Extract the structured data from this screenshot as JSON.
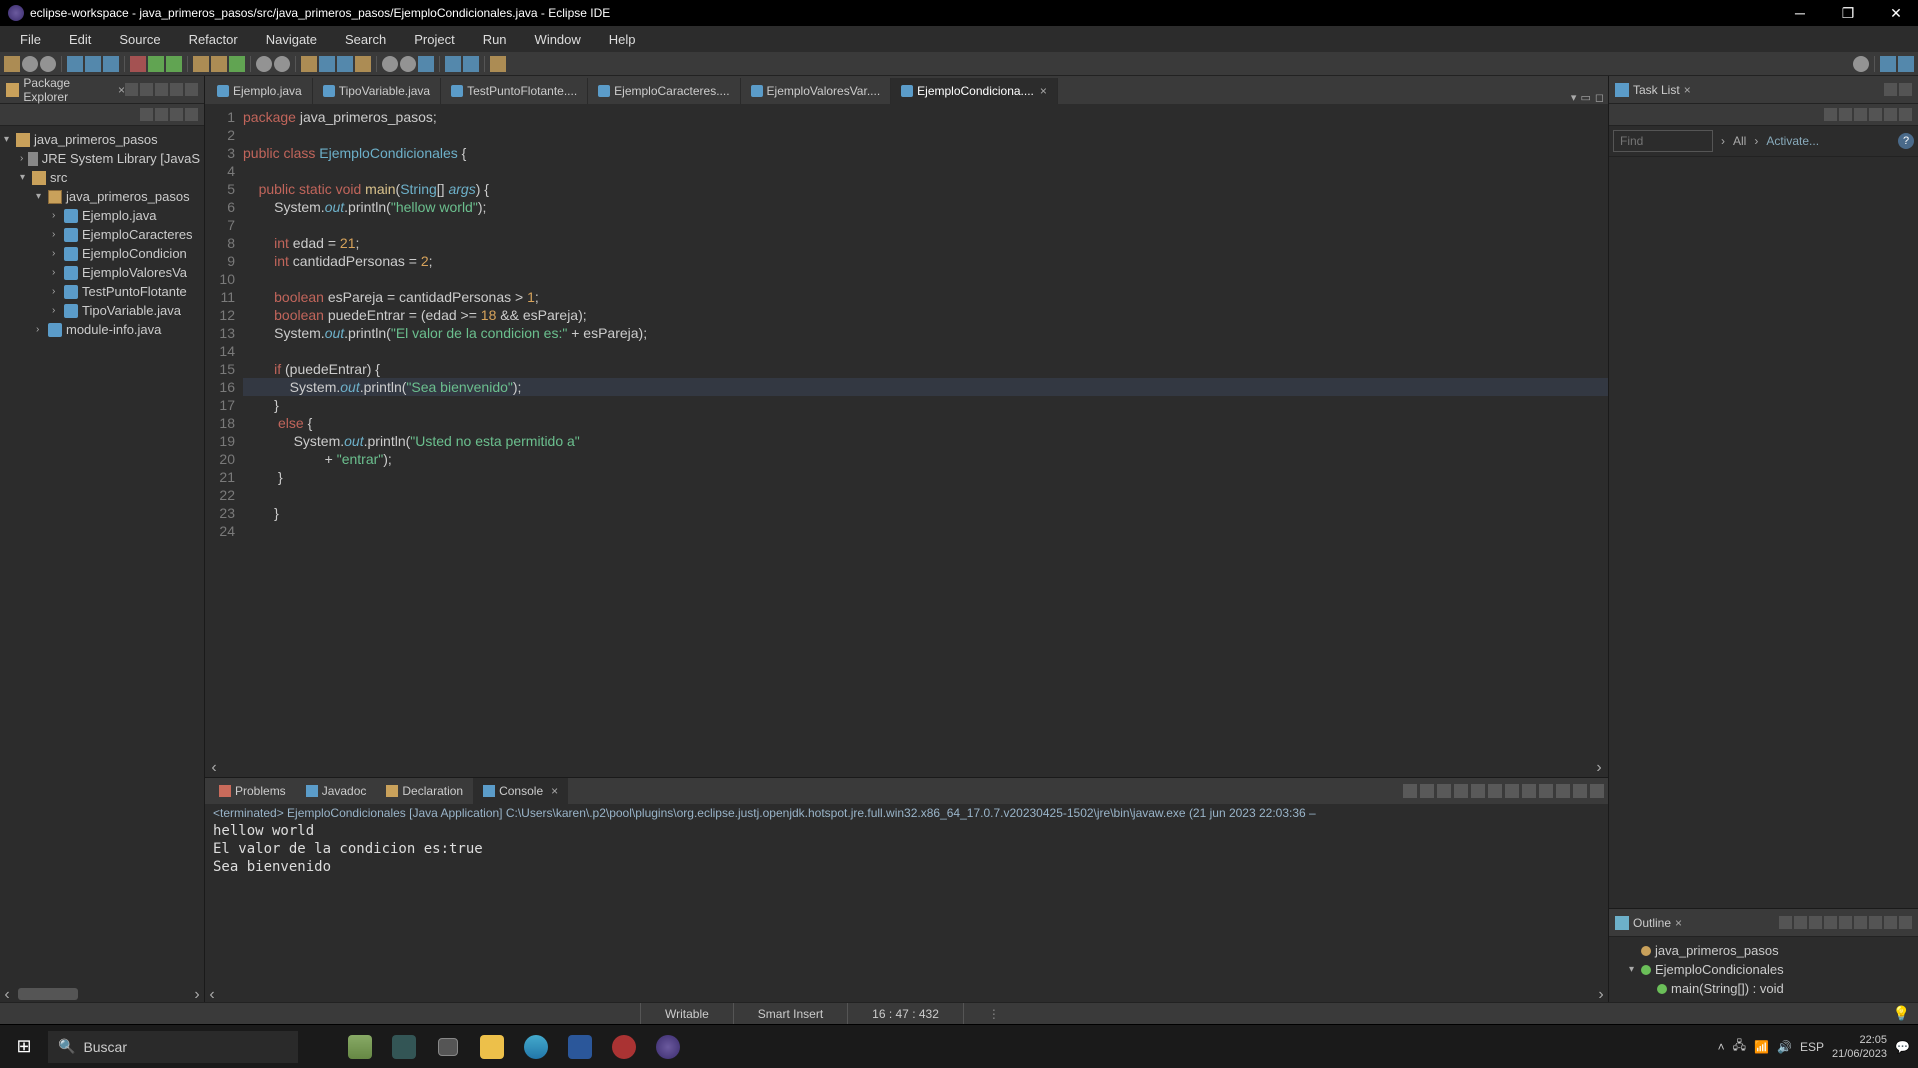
{
  "titlebar": {
    "title": "eclipse-workspace - java_primeros_pasos/src/java_primeros_pasos/EjemploCondicionales.java - Eclipse IDE"
  },
  "menu": [
    "File",
    "Edit",
    "Source",
    "Refactor",
    "Navigate",
    "Search",
    "Project",
    "Run",
    "Window",
    "Help"
  ],
  "package_explorer": {
    "title": "Package Explorer",
    "items": [
      {
        "label": "java_primeros_pasos",
        "icon": "icon-proj",
        "indent": 0,
        "arrow": "▾"
      },
      {
        "label": "JRE System Library [JavaS",
        "icon": "icon-lib",
        "indent": 1,
        "arrow": "›"
      },
      {
        "label": "src",
        "icon": "icon-folder",
        "indent": 1,
        "arrow": "▾"
      },
      {
        "label": "java_primeros_pasos",
        "icon": "icon-pkg",
        "indent": 2,
        "arrow": "▾"
      },
      {
        "label": "Ejemplo.java",
        "icon": "icon-java",
        "indent": 3,
        "arrow": "›"
      },
      {
        "label": "EjemploCaracteres",
        "icon": "icon-java",
        "indent": 3,
        "arrow": "›"
      },
      {
        "label": "EjemploCondicion",
        "icon": "icon-java",
        "indent": 3,
        "arrow": "›"
      },
      {
        "label": "EjemploValoresVa",
        "icon": "icon-java",
        "indent": 3,
        "arrow": "›"
      },
      {
        "label": "TestPuntoFlotante",
        "icon": "icon-java",
        "indent": 3,
        "arrow": "›"
      },
      {
        "label": "TipoVariable.java",
        "icon": "icon-java",
        "indent": 3,
        "arrow": "›"
      },
      {
        "label": "module-info.java",
        "icon": "icon-java",
        "indent": 2,
        "arrow": "›"
      }
    ]
  },
  "editor": {
    "tabs": [
      {
        "label": "Ejemplo.java",
        "active": false
      },
      {
        "label": "TipoVariable.java",
        "active": false
      },
      {
        "label": "TestPuntoFlotante....",
        "active": false
      },
      {
        "label": "EjemploCaracteres....",
        "active": false
      },
      {
        "label": "EjemploValoresVar....",
        "active": false
      },
      {
        "label": "EjemploCondiciona....",
        "active": true
      }
    ],
    "line_count": 24
  },
  "bottom": {
    "tabs": [
      {
        "label": "Problems",
        "active": false,
        "color": "#c96b5b"
      },
      {
        "label": "Javadoc",
        "active": false,
        "color": "#5b9cc9"
      },
      {
        "label": "Declaration",
        "active": false,
        "color": "#c9a15b"
      },
      {
        "label": "Console",
        "active": true,
        "color": "#5b9cc9"
      }
    ],
    "launch": "<terminated> EjemploCondicionales [Java Application] C:\\Users\\karen\\.p2\\pool\\plugins\\org.eclipse.justj.openjdk.hotspot.jre.full.win32.x86_64_17.0.7.v20230425-1502\\jre\\bin\\javaw.exe  (21 jun 2023 22:03:36 –",
    "output": "hellow world\nEl valor de la condicion es:true\nSea bienvenido"
  },
  "tasklist": {
    "title": "Task List",
    "find_placeholder": "Find",
    "crumb1": "All",
    "crumb2": "Activate..."
  },
  "outline": {
    "title": "Outline",
    "items": [
      {
        "label": "java_primeros_pasos",
        "indent": 0,
        "color": "#c9a15b",
        "arrow": ""
      },
      {
        "label": "EjemploCondicionales",
        "indent": 0,
        "color": "#6bbf59",
        "arrow": "▾"
      },
      {
        "label": "main(String[]) : void",
        "indent": 1,
        "color": "#6bbf59",
        "arrow": ""
      }
    ]
  },
  "status": {
    "writable": "Writable",
    "insert": "Smart Insert",
    "position": "16 : 47 : 432"
  },
  "taskbar": {
    "search": "Buscar",
    "lang": "ESP",
    "time": "22:05",
    "date": "21/06/2023"
  }
}
